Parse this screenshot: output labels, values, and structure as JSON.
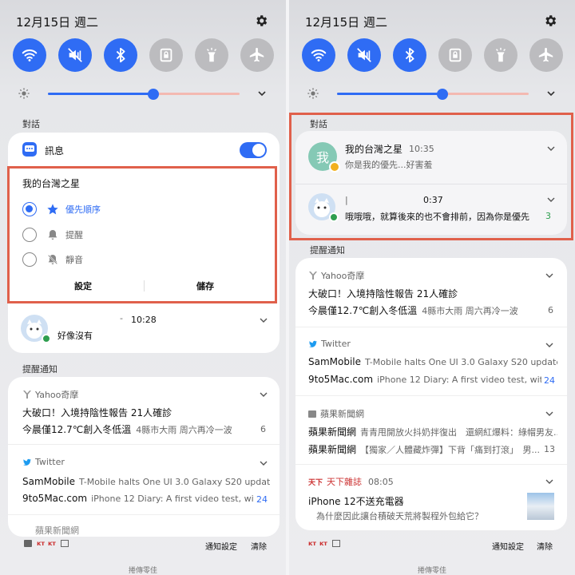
{
  "status": {
    "date": "12月15日 週二"
  },
  "quick_tiles": [
    {
      "name": "wifi-icon",
      "on": true
    },
    {
      "name": "mute-icon",
      "on": true
    },
    {
      "name": "bluetooth-icon",
      "on": true
    },
    {
      "name": "lock-rotation-icon",
      "on": false
    },
    {
      "name": "flashlight-icon",
      "on": false
    },
    {
      "name": "airplane-icon",
      "on": false
    }
  ],
  "brightness": {
    "level": 0.55
  },
  "colors": {
    "accent": "#2f6cf4",
    "highlight_box": "#e0604b",
    "badge_green": "#2e9e4f",
    "count_blue": "#2f6cf4"
  },
  "left": {
    "section_conversations": "對話",
    "app_label": "訊息",
    "priority_title": "我的台灣之星",
    "options": [
      "優先順序",
      "提醒",
      "靜音"
    ],
    "btn_settings": "設定",
    "btn_save": "儲存",
    "conv_time": "10:28",
    "conv_dash": "-",
    "conv_text": "好像沒有",
    "section_alerts": "提醒通知",
    "yahoo": {
      "source": "Yahoo奇摩",
      "title": "大破口！入境持陰性報告 21人確診",
      "sub_title": "今晨僅12.7℃創入冬低溫",
      "sub_text": "4縣市大雨 周六再冷一波",
      "count": "6"
    },
    "twitter": {
      "source": "Twitter",
      "r1_title": "SamMobile",
      "r1_text": "T-Mobile halts One UI 3.0 Galaxy S20 update fo...",
      "r2_title": "9to5Mac.com",
      "r2_text": "iPhone 12 Diary: A first video test, with...",
      "count": "24"
    },
    "apple_partial": "蘋果新聞網",
    "footer_settings": "通知設定",
    "footer_clear": "清除",
    "handle": "捲傳零佳"
  },
  "right": {
    "section_conversations": "對話",
    "conv1": {
      "name": "我的台灣之星",
      "time": "10:35",
      "avatar": "我",
      "text": "你是我的優先...好害羞"
    },
    "conv2": {
      "name": "|",
      "time": "0:37",
      "text": "哦哦哦，就算後來的也不會排前，因為你是優先",
      "count": "3"
    },
    "section_alerts": "提醒通知",
    "yahoo": {
      "source": "Yahoo奇摩",
      "title": "大破口！入境持陰性報告 21人確診",
      "sub_title": "今晨僅12.7℃創入冬低溫",
      "sub_text": "4縣市大雨 周六再冷一波",
      "count": "6"
    },
    "twitter": {
      "source": "Twitter",
      "r1_title": "SamMobile",
      "r1_text": "T-Mobile halts One UI 3.0 Galaxy S20 update fo...",
      "r2_title": "9to5Mac.com",
      "r2_text": "iPhone 12 Diary: A first video test, with...",
      "count": "24"
    },
    "apple": {
      "source": "蘋果新聞網",
      "r1_title": "蘋果新聞網",
      "r1_text": "青青甩開放火抖奶拌復出　還網紅爆料：綠帽男友...",
      "r2_title": "蘋果新聞網",
      "r2_text": "【獨家／人體藏炸彈】下背「痛到打滾」　男...",
      "count": "13"
    },
    "cw": {
      "logo": "天下",
      "source": "天下雜誌",
      "time": "08:05",
      "title": "iPhone 12不送充電器",
      "text": "為什麼因此讓台積破天荒將製程外包給它？"
    },
    "footer_settings": "通知設定",
    "footer_clear": "清除",
    "handle": "捲傳零佳"
  },
  "footer_icons": [
    "folder-icon",
    "logo-icon",
    "logo-icon",
    "image-icon"
  ]
}
